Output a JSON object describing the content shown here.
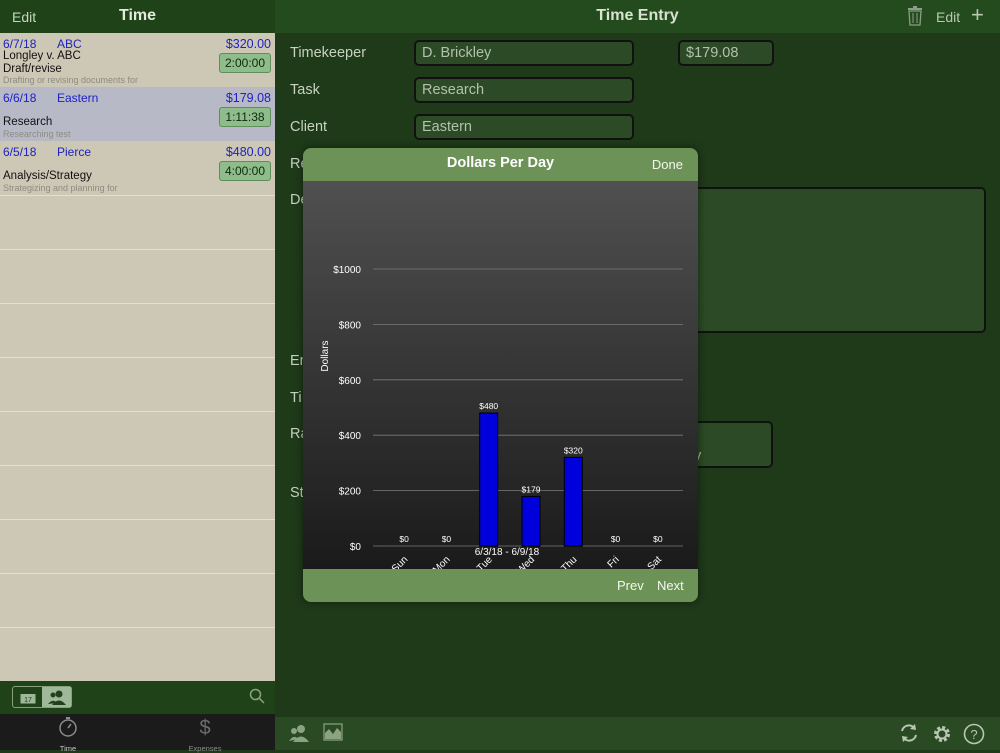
{
  "left": {
    "header": {
      "edit_label": "Edit",
      "title": "Time"
    },
    "entries": [
      {
        "date": "6/7/18",
        "client": "ABC",
        "amount": "$320.00",
        "matter": "Longley v. ABC",
        "task": "Draft/revise",
        "desc": "Drafting or revising documents for",
        "timer": "2:00:00"
      },
      {
        "date": "6/6/18",
        "client": "Eastern",
        "amount": "$179.08",
        "matter": "",
        "task": "Research",
        "desc": "Researching test",
        "timer": "1:11:38"
      },
      {
        "date": "6/5/18",
        "client": "Pierce",
        "amount": "$480.00",
        "matter": "",
        "task": "Analysis/Strategy",
        "desc": "Strategizing and planning for",
        "timer": "4:00:00"
      }
    ],
    "tabs": [
      {
        "label": "Time",
        "icon": "stopwatch-icon"
      },
      {
        "label": "Expenses",
        "icon": "dollar-icon"
      }
    ]
  },
  "right": {
    "header": {
      "title": "Time Entry",
      "edit_label": "Edit"
    },
    "fields": {
      "timekeeper_label": "Timekeeper",
      "timekeeper_value": "D. Brickley",
      "amount_value": "$179.08",
      "task_label": "Task",
      "task_value": "Research",
      "client_label": "Client",
      "client_value": "Eastern",
      "re_label": "Re",
      "de_label": "De",
      "en_label": "En",
      "ti_label": "Ti",
      "ra_label": "Ra",
      "ra_value": "rly",
      "st_label": "St"
    }
  },
  "popup": {
    "title": "Dollars Per Day",
    "done_label": "Done",
    "prev_label": "Prev",
    "next_label": "Next"
  },
  "colors": {
    "bar": "#0000dd",
    "header_green": "#6c9257",
    "entry_blue": "#1e22c4"
  },
  "chart_data": {
    "type": "bar",
    "categories": [
      "Sun",
      "Mon",
      "Tue",
      "Wed",
      "Thu",
      "Fri",
      "Sat"
    ],
    "values": [
      0,
      0,
      480,
      179,
      320,
      0,
      0
    ],
    "data_labels": [
      "$0",
      "$0",
      "$480",
      "$179",
      "$320",
      "$0",
      "$0"
    ],
    "title": "",
    "xlabel": "6/3/18 - 6/9/18",
    "ylabel": "Dollars",
    "ylim": [
      0,
      1000
    ],
    "yticks": [
      0,
      200,
      400,
      600,
      800,
      1000
    ],
    "ytick_labels": [
      "$0",
      "$200",
      "$400",
      "$600",
      "$800",
      "$1000"
    ],
    "grid": true
  }
}
